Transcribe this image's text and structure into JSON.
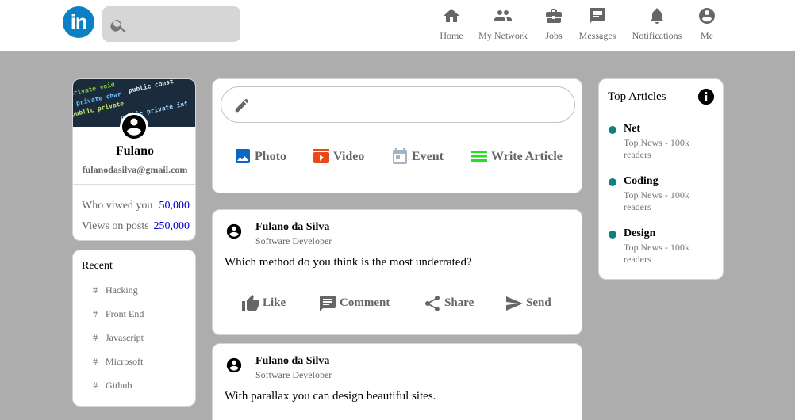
{
  "header": {
    "logo_text": "in",
    "search_placeholder": "",
    "nav": [
      {
        "label": "Home",
        "icon": "home-icon"
      },
      {
        "label": "My Network",
        "icon": "network-icon"
      },
      {
        "label": "Jobs",
        "icon": "briefcase-icon"
      },
      {
        "label": "Messages",
        "icon": "message-icon"
      },
      {
        "label": "Notifications",
        "icon": "bell-icon"
      },
      {
        "label": "Me",
        "icon": "account-icon"
      }
    ]
  },
  "profile": {
    "name": "Fulano",
    "email": "fulanodasilva@gmail.com",
    "stats": [
      {
        "label": "Who viwed you",
        "value": "50,000"
      },
      {
        "label": "Views on posts",
        "value": "250,000"
      }
    ],
    "cover_code": [
      "private void",
      "private char",
      "public private",
      "public const",
      "public private int"
    ]
  },
  "recent": {
    "title": "Recent",
    "items": [
      "Hacking",
      "Front End",
      "Javascript",
      "Microsoft",
      "Github"
    ]
  },
  "postbox": {
    "placeholder": "",
    "actions": [
      {
        "label": "Photo",
        "icon": "photo-icon",
        "color": "#0a66c2"
      },
      {
        "label": "Video",
        "icon": "video-icon",
        "color": "#e7491c"
      },
      {
        "label": "Event",
        "icon": "calendar-icon",
        "color": "#a5b4c4"
      },
      {
        "label": "Write Article",
        "icon": "article-icon",
        "color": "#1ee31e"
      }
    ]
  },
  "posts": [
    {
      "author": "Fulano da Silva",
      "role": "Software Developer",
      "text": "Which method do you think is the most underrated?",
      "reactions": [
        {
          "label": "Like",
          "icon": "thumb-up-icon"
        },
        {
          "label": "Comment",
          "icon": "comment-icon"
        },
        {
          "label": "Share",
          "icon": "share-icon"
        },
        {
          "label": "Send",
          "icon": "send-icon"
        }
      ]
    },
    {
      "author": "Fulano da Silva",
      "role": "Software Developer",
      "text": "With parallax you can design beautiful sites."
    }
  ],
  "articles": {
    "title": "Top Articles",
    "items": [
      {
        "title": "Net",
        "sub": "Top News - 100k readers"
      },
      {
        "title": "Coding",
        "sub": "Top News - 100k readers"
      },
      {
        "title": "Design",
        "sub": "Top News - 100k readers"
      }
    ]
  },
  "colors": {
    "brand": "#0b80c4",
    "background": "#adadad",
    "link": "#0000cd",
    "article_dot": "#0f8080"
  }
}
